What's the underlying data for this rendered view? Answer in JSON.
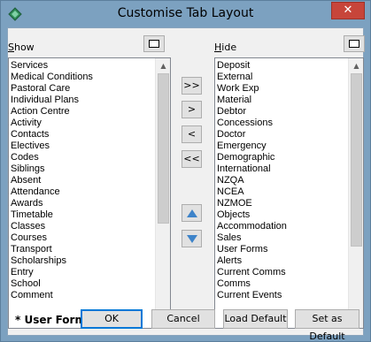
{
  "window": {
    "title": "Customise Tab Layout",
    "close_symbol": "✕"
  },
  "show_pane": {
    "label_prefix": "S",
    "label_rest": "how",
    "items": [
      "Services",
      "Medical Conditions",
      "Pastoral Care",
      "Individual Plans",
      "Action Centre",
      "Activity",
      "Contacts",
      "Electives",
      "Codes",
      "Siblings",
      "Absent",
      "Attendance",
      "Awards",
      "Timetable",
      "Classes",
      "Courses",
      "Transport",
      "Scholarships",
      "Entry",
      "School",
      "Comment"
    ]
  },
  "hide_pane": {
    "label_prefix": "H",
    "label_rest": "ide",
    "items": [
      "Deposit",
      "External",
      "Work Exp",
      "Material",
      "Debtor",
      "Concessions",
      "Doctor",
      "Emergency",
      "Demographic",
      "International",
      "NZQA",
      "NCEA",
      "NZMOE",
      "Objects",
      "Accommodation",
      "Sales",
      "User Forms",
      "Alerts",
      "Current Comms",
      "Comms",
      "Current Events"
    ]
  },
  "move_buttons": {
    "move_all_right": ">>",
    "move_right": ">",
    "move_left": "<",
    "move_all_left": "<<"
  },
  "icons": {
    "app": "app-diamond-icon",
    "up": "triangle-up-icon",
    "down": "triangle-down-icon",
    "accent": "#3d83c9"
  },
  "footer": {
    "user_form_label": "* User Form",
    "ok": "OK",
    "cancel": "Cancel",
    "load_default": "Load Default",
    "set_as_default": "Set as Default"
  }
}
